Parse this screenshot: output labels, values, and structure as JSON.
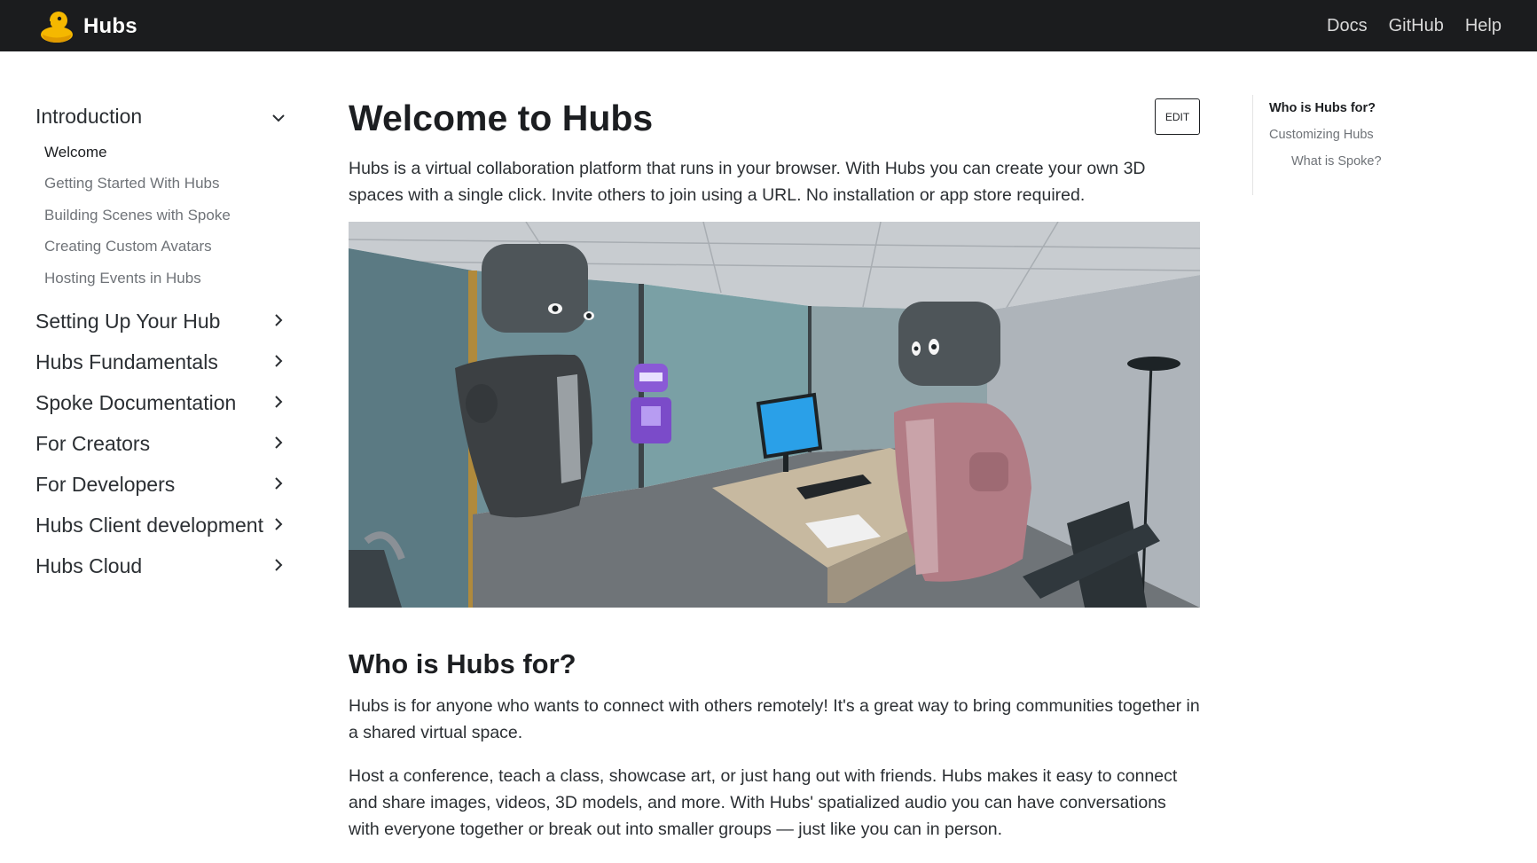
{
  "header": {
    "brand": "Hubs",
    "links": [
      "Docs",
      "GitHub",
      "Help"
    ]
  },
  "sidebar": {
    "open_category": "Introduction",
    "sub_items": [
      {
        "label": "Welcome",
        "active": true
      },
      {
        "label": "Getting Started With Hubs",
        "active": false
      },
      {
        "label": "Building Scenes with Spoke",
        "active": false
      },
      {
        "label": "Creating Custom Avatars",
        "active": false
      },
      {
        "label": "Hosting Events in Hubs",
        "active": false
      }
    ],
    "categories": [
      "Setting Up Your Hub",
      "Hubs Fundamentals",
      "Spoke Documentation",
      "For Creators",
      "For Developers",
      "Hubs Client development",
      "Hubs Cloud"
    ]
  },
  "main": {
    "title": "Welcome to Hubs",
    "edit_label": "EDIT",
    "intro": "Hubs is a virtual collaboration platform that runs in your browser. With Hubs you can create your own 3D spaces with a single click. Invite others to join using a URL. No installation or app store required.",
    "section_title": "Who is Hubs for?",
    "para2": "Hubs is for anyone who wants to connect with others remotely! It's a great way to bring communities together in a shared virtual space.",
    "para3": "Host a conference, teach a class, showcase art, or just hang out with friends. Hubs makes it easy to connect and share images, videos, 3D models, and more. With Hubs' spatialized audio you can have conversations with everyone together or break out into smaller groups — just like you can in person."
  },
  "toc": {
    "items": [
      {
        "label": "Who is Hubs for?",
        "active": true,
        "level": 1
      },
      {
        "label": "Customizing Hubs",
        "active": false,
        "level": 1
      },
      {
        "label": "What is Spoke?",
        "active": false,
        "level": 2
      }
    ]
  },
  "colors": {
    "topbar": "#1b1c1e",
    "duck": "#f5b800",
    "text": "#1c1e21",
    "muted": "#6f7378"
  },
  "icons": {
    "brand": "duck-logo-icon",
    "expand": "chevron-down-icon",
    "collapse": "chevron-right-icon"
  }
}
